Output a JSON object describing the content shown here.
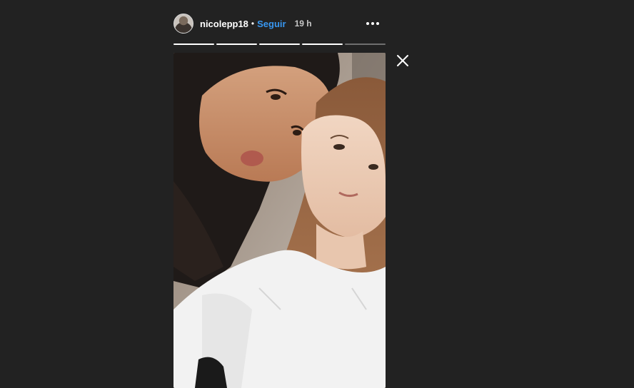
{
  "story": {
    "username": "nicolepp18",
    "separator": "•",
    "follow_label": "Seguir",
    "time_ago": "19 h",
    "progress": [
      1,
      1,
      1,
      1,
      0
    ]
  },
  "icons": {
    "more": "more-horizontal-icon",
    "close": "close-icon"
  },
  "colors": {
    "background": "#222222",
    "accent": "#3897f0",
    "text": "#ffffff",
    "muted": "#c7c7c7"
  }
}
